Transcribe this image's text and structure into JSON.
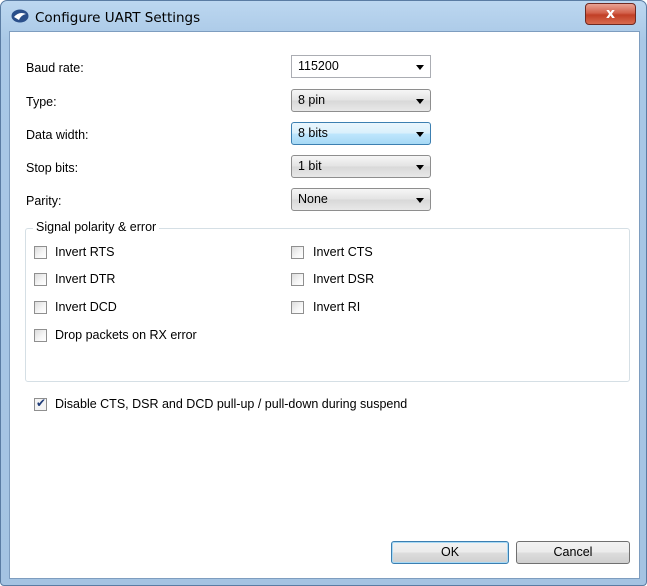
{
  "window": {
    "title": "Configure UART Settings",
    "close_glyph": "x",
    "title_icon": "cypress-logo-icon"
  },
  "settings": [
    {
      "label": "Baud rate:",
      "value": "115200"
    },
    {
      "label": "Type:",
      "value": "8 pin"
    },
    {
      "label": "Data width:",
      "value": "8 bits"
    },
    {
      "label": "Stop bits:",
      "value": "1 bit"
    },
    {
      "label": "Parity:",
      "value": "None"
    }
  ],
  "signal_group": {
    "title": "Signal polarity & error",
    "checkboxes": [
      {
        "label": "Invert RTS",
        "checked": false
      },
      {
        "label": "Invert DTR",
        "checked": false
      },
      {
        "label": "Invert DCD",
        "checked": false
      },
      {
        "label": "Drop packets on RX error",
        "checked": false
      },
      {
        "label": "Invert CTS",
        "checked": false
      },
      {
        "label": "Invert DSR",
        "checked": false
      },
      {
        "label": "Invert RI",
        "checked": false
      }
    ]
  },
  "suspend_option": {
    "label": "Disable CTS, DSR and DCD pull-up / pull-down during suspend",
    "checked": true
  },
  "buttons": {
    "ok": "OK",
    "cancel": "Cancel"
  },
  "colors": {
    "focus_border": "#3c7fb1",
    "close_button": "#c13f26"
  }
}
